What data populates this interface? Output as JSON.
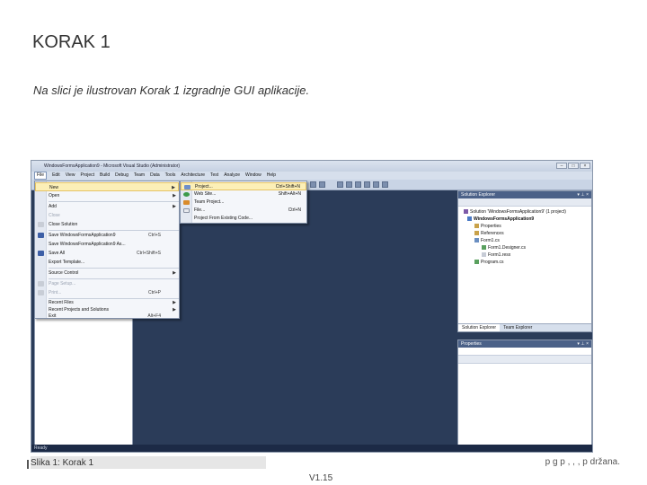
{
  "slide": {
    "title": "KORAK 1",
    "subtitle": "Na slici je ilustrovan  Korak 1 izgradnje GUI aplikacije.",
    "caption": "Slika 1: Korak 1",
    "footer_fragment": "p        g               p  ,          ,   ,        p       držana.",
    "version": "V1.15"
  },
  "window": {
    "title": "WindowsFormsApplication9 - Microsoft Visual Studio (Administrator)",
    "status": "Ready",
    "menus": [
      "File",
      "Edit",
      "View",
      "Project",
      "Build",
      "Debug",
      "Team",
      "Data",
      "Tools",
      "Architecture",
      "Test",
      "Analyze",
      "Window",
      "Help"
    ]
  },
  "file_menu": {
    "items": [
      {
        "label": "New",
        "shortcut": "",
        "arrow": true,
        "highlighted": true
      },
      {
        "label": "Open",
        "shortcut": "",
        "arrow": true
      },
      {
        "label": "Add",
        "shortcut": "",
        "arrow": true
      },
      {
        "label": "Close",
        "shortcut": "",
        "disabled": true
      },
      {
        "label": "Close Solution",
        "shortcut": ""
      },
      {
        "label": "Save WindowsFormsApplication9",
        "shortcut": "Ctrl+S"
      },
      {
        "label": "Save WindowsFormsApplication9 As...",
        "shortcut": ""
      },
      {
        "label": "Save All",
        "shortcut": "Ctrl+Shift+S"
      },
      {
        "label": "Export Template...",
        "shortcut": ""
      },
      {
        "label": "Source Control",
        "shortcut": "",
        "arrow": true
      },
      {
        "label": "Page Setup...",
        "shortcut": "",
        "disabled": true
      },
      {
        "label": "Print...",
        "shortcut": "Ctrl+P",
        "disabled": true
      },
      {
        "label": "Recent Files",
        "shortcut": "",
        "arrow": true
      },
      {
        "label": "Recent Projects and Solutions",
        "shortcut": "",
        "arrow": true
      },
      {
        "label": "Exit",
        "shortcut": "Alt+F4"
      }
    ]
  },
  "new_submenu": {
    "items": [
      {
        "label": "Project...",
        "shortcut": "Ctrl+Shift+N"
      },
      {
        "label": "Web Site...",
        "shortcut": "Shift+Alt+N"
      },
      {
        "label": "Team Project...",
        "shortcut": ""
      },
      {
        "label": "File...",
        "shortcut": "Ctrl+N"
      },
      {
        "label": "Project From Existing Code...",
        "shortcut": ""
      }
    ]
  },
  "solution_explorer": {
    "title": "Solution Explorer",
    "tree": [
      "Solution 'WindowsFormsApplication9' (1 project)",
      "WindowsFormsApplication9",
      "Properties",
      "References",
      "Form1.cs",
      "Form1.Designer.cs",
      "Form1.resx",
      "Program.cs"
    ],
    "tabs": [
      "Solution Explorer",
      "Team Explorer"
    ]
  },
  "properties": {
    "title": "Properties"
  }
}
